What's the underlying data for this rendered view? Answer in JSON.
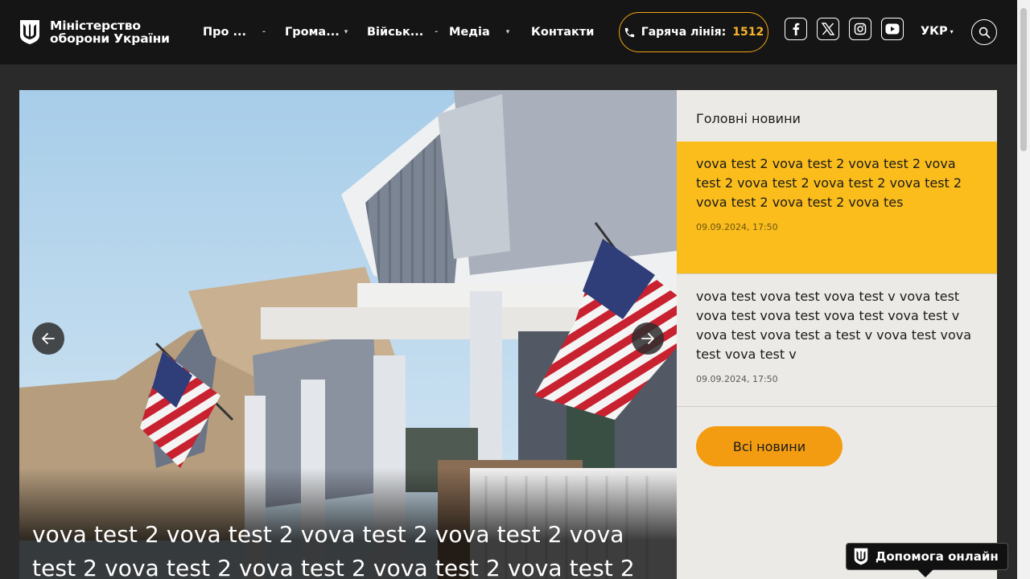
{
  "header": {
    "logo_line1": "Міністерство",
    "logo_line2": "оборони України",
    "nav": [
      {
        "label": "Про ..."
      },
      {
        "label": "Грома..."
      },
      {
        "label": "Військ..."
      },
      {
        "label": "Медіа"
      },
      {
        "label": "Контакти"
      }
    ],
    "hotline_label": "Гаряча лінія:",
    "hotline_number": "1512",
    "language": "УКР",
    "social_icons": [
      "facebook-icon",
      "x-icon",
      "instagram-icon",
      "youtube-icon"
    ]
  },
  "hero": {
    "title": "vova test 2 vova test 2 vova test 2 vova test 2 vova test 2 vova test 2 vova test 2 vova test 2 vova test 2"
  },
  "news": {
    "heading": "Головні новини",
    "items": [
      {
        "title": "vova test 2 vova test 2 vova test 2 vova test 2 vova test 2 vova test 2 vova test 2 vova test 2 vova test 2 vova tes",
        "date": "09.09.2024, 17:50",
        "active": true
      },
      {
        "title": "vova test vova test vova test v vova test vova test vova test vova test vova test v vova test vova test a test v vova test vova test vova test v",
        "date": "09.09.2024, 17:50",
        "active": false
      }
    ],
    "all_news_label": "Всі новини"
  },
  "help_widget": {
    "label": "Допомога онлайн"
  },
  "colors": {
    "accent": "#fbbd1c",
    "button": "#f39c12",
    "header_bg": "#151515",
    "panel_bg": "#eceae6"
  }
}
